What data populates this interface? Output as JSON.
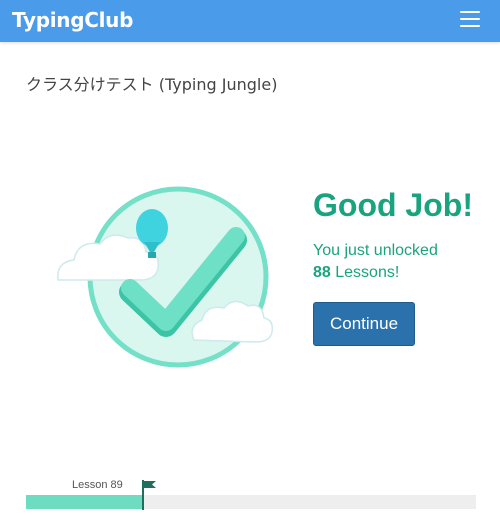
{
  "app": {
    "brand": "TypingClub",
    "menu_icon": "hamburger-menu-icon"
  },
  "page": {
    "title": "クラス分けテスト (Typing Jungle)"
  },
  "result": {
    "headline": "Good Job!",
    "unlock_prefix": "You just unlocked",
    "unlock_count": "88",
    "unlock_suffix": "Lessons!",
    "continue_label": "Continue"
  },
  "progress": {
    "lesson_label": "Lesson 89",
    "fraction": 0.26
  },
  "colors": {
    "header": "#4a9bea",
    "accent": "#1aa37f",
    "button": "#2b72ad",
    "progress_fill": "#6ddcc0",
    "checkmark": "#5fd9bd",
    "balloon": "#3ed3df"
  },
  "icons": {
    "illustration": "checkmark-with-clouds-and-balloon-icon",
    "flag": "flag-icon"
  }
}
